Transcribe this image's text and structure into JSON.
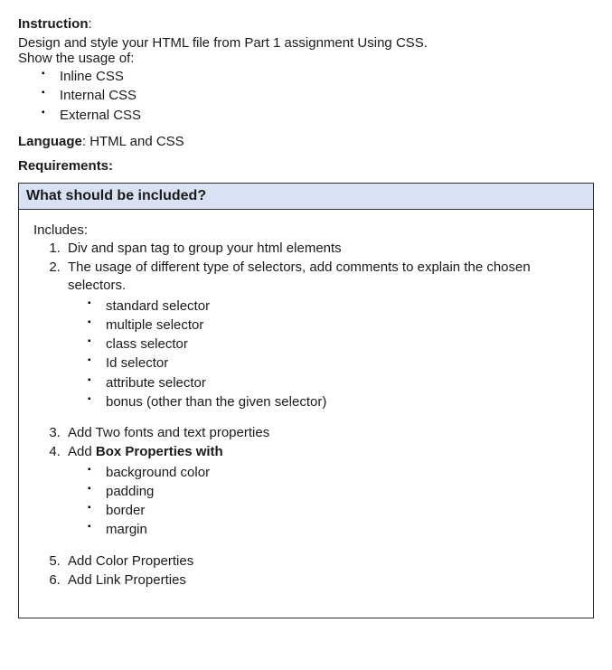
{
  "instruction": {
    "label": "Instruction",
    "text1": "Design and style your HTML file from Part 1 assignment Using CSS.",
    "text2": "Show the usage of:",
    "items": [
      "Inline CSS",
      "Internal CSS",
      "External CSS"
    ]
  },
  "language": {
    "label": "Language",
    "value": "HTML and CSS"
  },
  "requirements": {
    "label": "Requirements:"
  },
  "box": {
    "header": "What should be included?",
    "includes_label": "Includes:",
    "items": {
      "1": "Div and span tag to group your html elements",
      "2": "The usage of different type of selectors, add comments to explain the chosen selectors.",
      "2_sub": [
        "standard selector",
        "multiple selector",
        "class selector",
        "Id selector",
        "attribute selector",
        "bonus (other than the given selector)"
      ],
      "3": "Add Two fonts and text properties",
      "4_pre": "Add ",
      "4_bold": "Box Properties with",
      "4_sub": [
        "background color",
        "padding",
        "border",
        "margin"
      ],
      "5": "Add Color Properties",
      "6": "Add Link Properties"
    }
  }
}
